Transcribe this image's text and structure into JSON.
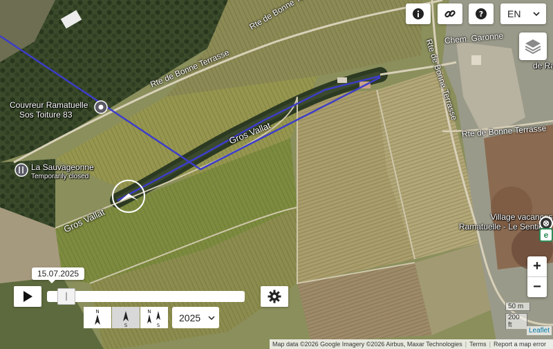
{
  "toolbar": {
    "info_icon": "info-icon",
    "link_icon": "link-icon",
    "help_icon": "help-icon",
    "language": "EN"
  },
  "map": {
    "road_labels": [
      "Rte de Bonne Terrasse",
      "Rte de Bonne Terrasse",
      "Rte de Bonne Terrasse",
      "Rte de Bonne Terrasse",
      "Chem. Garonne"
    ],
    "stream_labels": [
      "Gros Vallat",
      "Gros Vallat"
    ],
    "pois": {
      "couvreur_line1": "Couvreur Ramatuelle",
      "couvreur_line2": "Sos Toiture 83",
      "sauvageonne_name": "La Sauvageonne",
      "sauvageonne_status": "Temporarily closed",
      "village_line1": "Village vacances",
      "village_line2": "Ramatuelle - Le Sentier...",
      "edge_label": "de Ra"
    },
    "route_color": "#3d3dc9"
  },
  "timeline": {
    "date": "15.07.2025",
    "position": 0.05,
    "year": "2025",
    "compass_labels": {
      "north": "N",
      "south": "S"
    }
  },
  "zoom": {
    "in": "+",
    "out": "−"
  },
  "scale": {
    "metric": "50 m",
    "imperial": "200 ft"
  },
  "attribution": {
    "data": "Map data ©2026 Google Imagery ©2026 Airbus, Maxar Technologies",
    "terms": "Terms",
    "report": "Report a map error",
    "leaflet": "Leaflet"
  },
  "side_badges": {
    "top": "⊗",
    "bottom": "e"
  }
}
